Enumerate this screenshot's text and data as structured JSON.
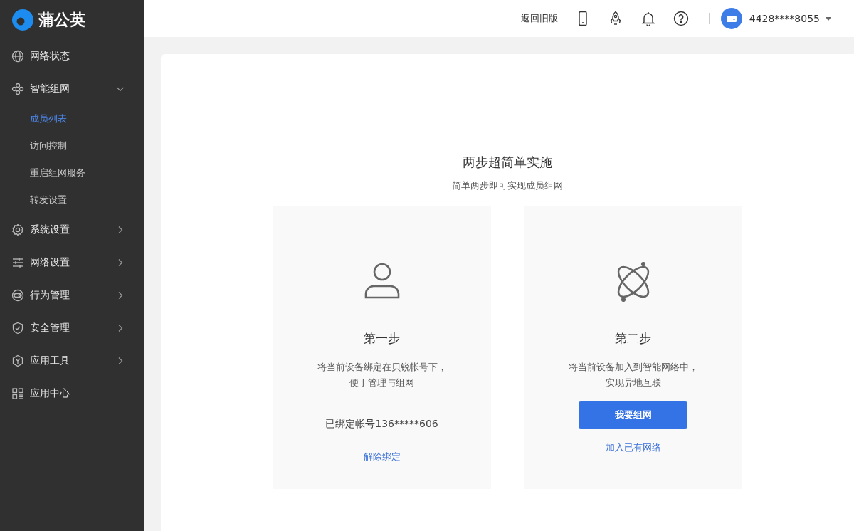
{
  "brand": {
    "name": "蒲公英"
  },
  "sidebar": {
    "items": [
      {
        "label": "网络状态"
      },
      {
        "label": "智能组网",
        "expanded": true,
        "children": [
          {
            "label": "成员列表",
            "selected": true
          },
          {
            "label": "访问控制",
            "selected": false
          },
          {
            "label": "重启组网服务",
            "selected": false
          },
          {
            "label": "转发设置",
            "selected": false
          }
        ]
      },
      {
        "label": "系统设置",
        "expanded": false
      },
      {
        "label": "网络设置",
        "expanded": false
      },
      {
        "label": "行为管理",
        "expanded": false
      },
      {
        "label": "安全管理",
        "expanded": false
      },
      {
        "label": "应用工具",
        "expanded": false
      },
      {
        "label": "应用中心"
      }
    ]
  },
  "header": {
    "back_link": "返回旧版",
    "account": "4428****8055"
  },
  "main": {
    "title": "两步超简单实施",
    "subtitle": "简单两步即可实现成员组网",
    "steps": [
      {
        "kind": "bind",
        "title": "第一步",
        "description": [
          "将当前设备绑定在贝锐帐号下，",
          "便于管理与组网"
        ],
        "status": "已绑定帐号136*****606",
        "link": "解除绑定"
      },
      {
        "kind": "join",
        "title": "第二步",
        "description": [
          "将当前设备加入到智能网络中，",
          "实现异地互联"
        ],
        "button": "我要组网",
        "link": "加入已有网络"
      }
    ]
  }
}
